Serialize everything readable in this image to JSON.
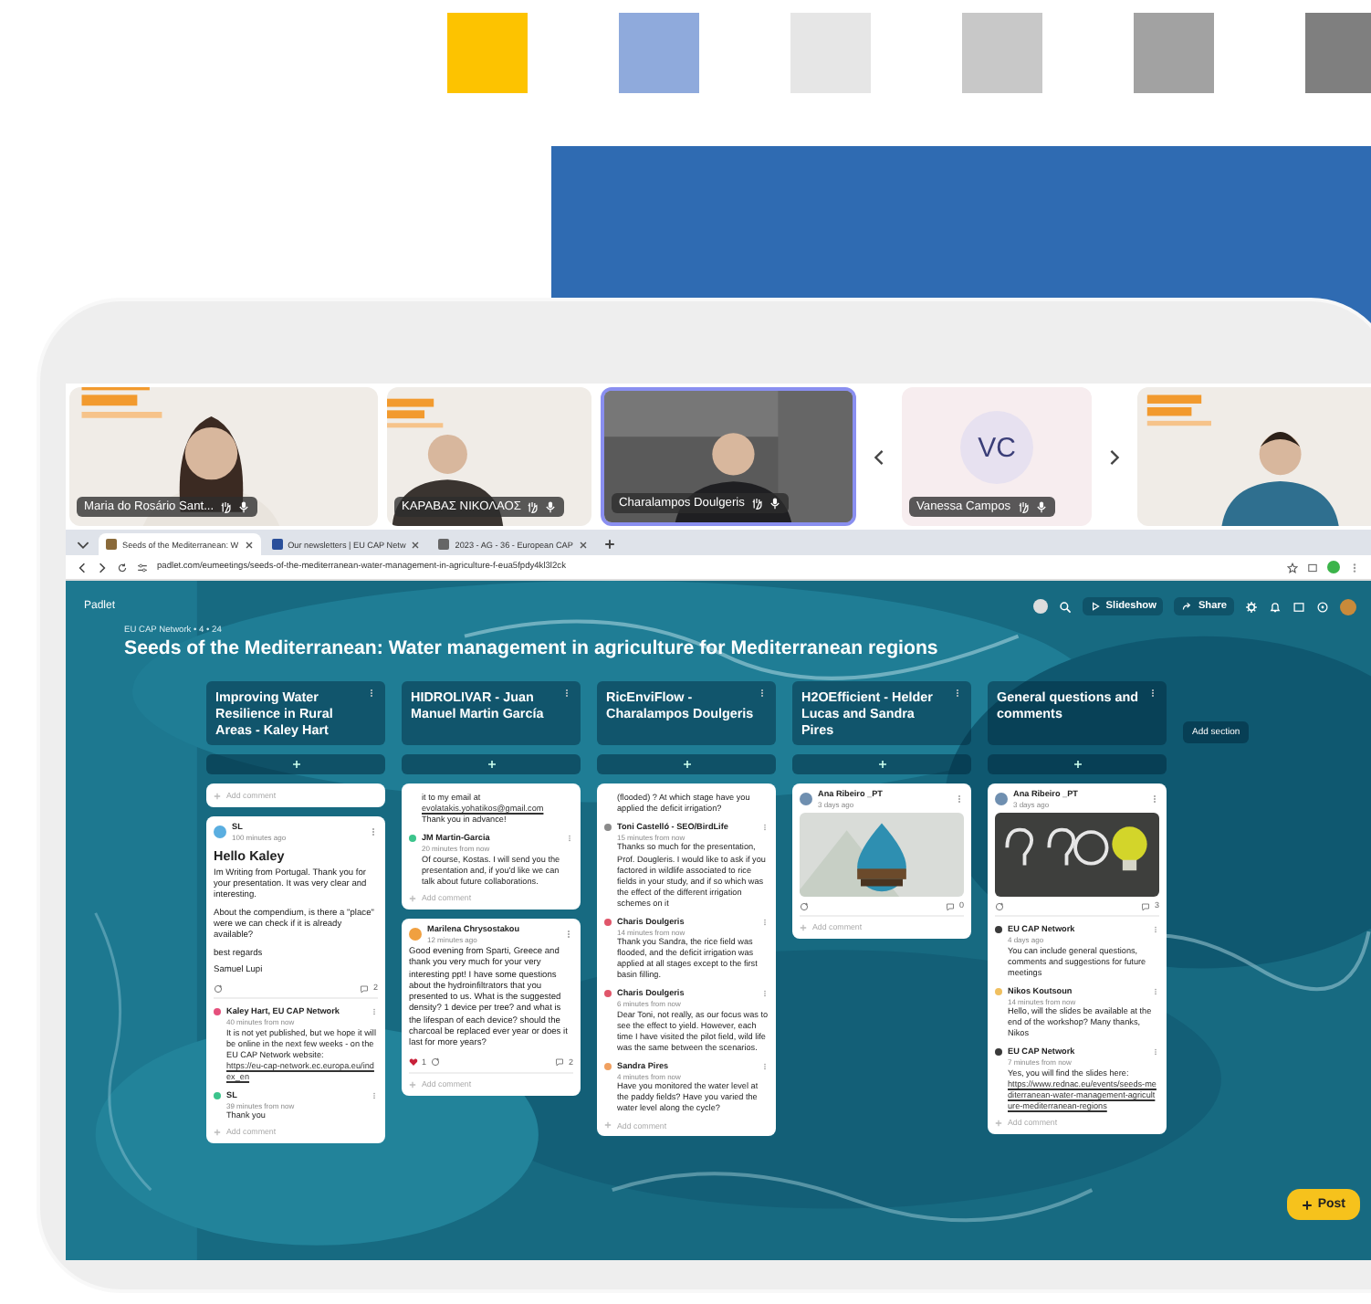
{
  "swatches": [
    {
      "color": "#fdc300"
    },
    {
      "color": "#8faadc"
    },
    {
      "color": "#e6e6e6"
    },
    {
      "color": "#c8c8c8"
    },
    {
      "color": "#a2a2a2"
    },
    {
      "color": "#7f7f7f"
    }
  ],
  "call": {
    "tiles": [
      {
        "kind": "video",
        "name": "Maria do Rosário Sant...",
        "selected": false
      },
      {
        "kind": "video",
        "name": "ΚΑΡΑΒΑΣ ΝΙΚΟΛΑΟΣ",
        "selected": false
      },
      {
        "kind": "video",
        "name": "Charalampos Doulgeris",
        "selected": true
      },
      {
        "kind": "prev"
      },
      {
        "kind": "initials",
        "initials": "VC",
        "name": "Vanessa Campos",
        "selected": false
      },
      {
        "kind": "next"
      },
      {
        "kind": "video",
        "selected": false
      }
    ]
  },
  "browser": {
    "tabs": [
      {
        "label": "Seeds of the Mediterranean: W",
        "selected": true
      },
      {
        "label": "Our newsletters | EU CAP Netw",
        "selected": false
      },
      {
        "label": "2023 - AG - 36 - European CAP",
        "selected": false
      }
    ],
    "url": "padlet.com/eumeetings/seeds-of-the-mediterranean-water-management-in-agriculture-f-eua5fpdy4kl3l2ck"
  },
  "padlet": {
    "brand": "Padlet",
    "toolbar": [
      "Slideshow",
      "Share"
    ],
    "breadcrumb": "EU CAP Network • 4 • 24",
    "title": "Seeds of the Mediterranean: Water management in agriculture for Mediterranean regions",
    "columns": [
      {
        "title": "Improving Water Resilience in Rural Areas - Kaley Hart",
        "posts": [
          {
            "add_comment": "Add comment"
          },
          {
            "author": "SL",
            "time": "100 minutes ago",
            "color": "#5aaee0",
            "heading": "Hello Kaley",
            "body": [
              "Im Writing from Portugal. Thank you for your presentation. It was very clear and interesting.",
              "About the compendium, is there a \"place\" were we can check if it is already available?",
              "best regards",
              "Samuel Lupi"
            ],
            "comment_count": "2",
            "comments": [
              {
                "author": "Kaley Hart, EU CAP Network",
                "time": "40 minutes from now",
                "color": "#e5507c",
                "text": "It is not yet published, but we hope it will be online in the next few weeks - on the EU CAP Network website:",
                "link": "https://eu-cap-network.ec.europa.eu/index_en"
              },
              {
                "author": "SL",
                "time": "39 minutes from now",
                "color": "#3cc48c",
                "text": "Thank you"
              }
            ],
            "add_comment": "Add comment"
          }
        ]
      },
      {
        "title": "HIDROLIVAR - Juan Manuel Martin García",
        "posts": [
          {
            "comments": [
              {
                "text": "it to my email at",
                "link": "evolatakis.yohatikos@gmail.com",
                "text_after": "Thank you in advance!"
              },
              {
                "author": "JM Martin-Garcia",
                "time": "20 minutes from now",
                "color": "#3cc48c",
                "text": "Of course, Kostas. I will send you the presentation and, if you'd like we can talk about future collaborations."
              }
            ],
            "add_comment": "Add comment"
          },
          {
            "author": "Marilena Chrysostakou",
            "time": "12 minutes ago",
            "color": "#f0a040",
            "body": [
              "Good evening from Sparti, Greece and thank you very much for your very interesting ppt! I have some questions about the hydroinfiltrators that you presented to us. What is the suggested density? 1 device per tree? and what is the lifespan of each device? should the charcoal be replaced ever year or does it last for more years?"
            ],
            "likes": "1",
            "comment_count": "2",
            "add_comment": "Add comment"
          }
        ]
      },
      {
        "title": "RicEnviFlow - Charalampos Doulgeris",
        "posts": [
          {
            "comments": [
              {
                "text": "(flooded) ? At which stage have you applied the deficit irrigation?"
              },
              {
                "author": "Toni Castelló - SEO/BirdLife",
                "time": "15 minutes from now",
                "color": "#8a8a8a",
                "text": "Thanks so much for the presentation, Prof. Dougleris. I would like to ask if you factored in wildlife associated to rice fields in your study, and if so which was the effect of the different irrigation schemes on it"
              },
              {
                "author": "Charis Doulgeris",
                "time": "14 minutes from now",
                "color": "#e0566a",
                "text": "Thank you Sandra, the rice field was flooded, and the deficit irrigation was applied at all stages except to the first basin filling."
              },
              {
                "author": "Charis Doulgeris",
                "time": "6 minutes from now",
                "color": "#e0566a",
                "text": "Dear Toni, not really, as our focus was to see the effect to yield. However, each time I have visited the pilot field, wild life was the same between the scenarios."
              },
              {
                "author": "Sandra Pires",
                "time": "4 minutes from now",
                "color": "#f0a060",
                "text": "Have you monitored the water level at the paddy fields? Have you varied the water level along the cycle?"
              }
            ],
            "add_comment": "Add comment"
          }
        ]
      },
      {
        "title": "H2OEfficient - Helder Lucas and Sandra Pires",
        "posts": [
          {
            "author": "Ana Ribeiro _PT",
            "time": "3 days ago",
            "color": "#6f8fb0",
            "media": {
              "kind": "picture"
            },
            "comment_count": "0",
            "add_comment": "Add comment"
          }
        ]
      },
      {
        "title": "General questions and comments",
        "posts": [
          {
            "author": "Ana Ribeiro _PT",
            "time": "3 days ago",
            "color": "#6f8fb0",
            "media": {
              "kind": "picture"
            },
            "comment_count": "3",
            "comments": [
              {
                "author": "EU CAP Network",
                "time": "4 days ago",
                "color": "#3a3a3a",
                "text": "You can include general questions, comments and suggestions for future meetings"
              },
              {
                "author": "Nikos Koutsoun",
                "time": "14 minutes from now",
                "color": "#f0c060",
                "text": "Hello, will the slides be available at the end of the workshop? Many thanks, Nikos"
              },
              {
                "author": "EU CAP Network",
                "time": "7 minutes from now",
                "color": "#3a3a3a",
                "text": "Yes, you will find the slides here:",
                "link": "https://www.rednac.eu/events/seeds-mediterranean-water-management-agriculture-mediterranean-regions"
              }
            ],
            "add_comment": "Add comment"
          }
        ]
      }
    ],
    "add_section": "Add section",
    "post_button": "Post"
  }
}
